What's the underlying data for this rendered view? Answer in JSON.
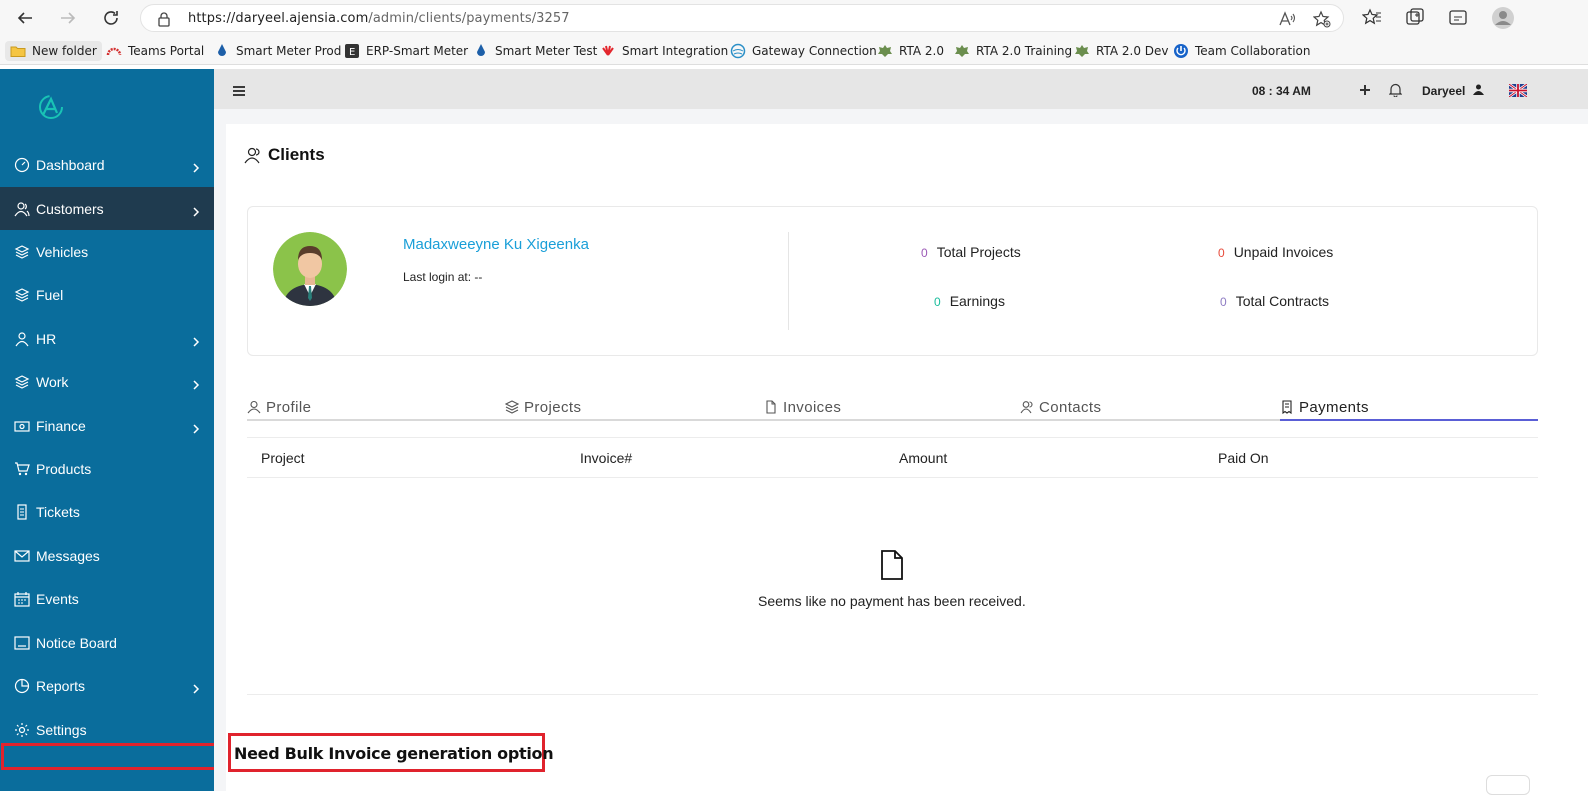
{
  "browser": {
    "url_host": "https://daryeel.ajensia.com",
    "url_path": "/admin/clients/payments/3257"
  },
  "bookmarks": [
    {
      "label": "New folder",
      "icon": "folder-icon"
    },
    {
      "label": "Teams Portal",
      "icon": "teams-portal-icon"
    },
    {
      "label": "Smart Meter Prod",
      "icon": "droplet-icon"
    },
    {
      "label": "ERP-Smart Meter",
      "icon": "e-badge-icon"
    },
    {
      "label": "Smart Meter Test",
      "icon": "droplet-icon"
    },
    {
      "label": "Smart Integration",
      "icon": "huawei-icon"
    },
    {
      "label": "Gateway Connection",
      "icon": "globe-icon"
    },
    {
      "label": "RTA 2.0",
      "icon": "emblem-icon"
    },
    {
      "label": "RTA 2.0 Training",
      "icon": "emblem-icon"
    },
    {
      "label": "RTA 2.0 Dev",
      "icon": "emblem-icon"
    },
    {
      "label": "Team Collaboration",
      "icon": "power-icon"
    }
  ],
  "sidebar": {
    "items": [
      {
        "label": "Dashboard",
        "icon": "dashboard-icon",
        "chevron": true
      },
      {
        "label": "Customers",
        "icon": "users-icon",
        "chevron": true,
        "active": true
      },
      {
        "label": "Vehicles",
        "icon": "layers-icon"
      },
      {
        "label": "Fuel",
        "icon": "layers-icon"
      },
      {
        "label": "HR",
        "icon": "user-icon",
        "chevron": true
      },
      {
        "label": "Work",
        "icon": "layers-icon",
        "chevron": true
      },
      {
        "label": "Finance",
        "icon": "money-icon",
        "chevron": true
      },
      {
        "label": "Products",
        "icon": "cart-icon"
      },
      {
        "label": "Tickets",
        "icon": "ticket-icon"
      },
      {
        "label": "Messages",
        "icon": "mail-icon"
      },
      {
        "label": "Events",
        "icon": "calendar-icon"
      },
      {
        "label": "Notice Board",
        "icon": "board-icon"
      },
      {
        "label": "Reports",
        "icon": "pie-icon",
        "chevron": true
      },
      {
        "label": "Settings",
        "icon": "gear-icon"
      }
    ]
  },
  "topbar": {
    "time": "08 : 34 AM",
    "user": "Daryeel"
  },
  "page": {
    "title": "Clients"
  },
  "client": {
    "name": "Madaxweeyne Ku Xigeenka",
    "last_login": "Last login at: --",
    "stats": [
      {
        "value": "0",
        "label": "Total Projects",
        "color": "#9b59b6"
      },
      {
        "value": "0",
        "label": "Unpaid Invoices",
        "color": "#e74c3c"
      },
      {
        "value": "0",
        "label": "Earnings",
        "color": "#1abc9c"
      },
      {
        "value": "0",
        "label": "Total Contracts",
        "color": "#8e7cc3"
      }
    ]
  },
  "tabs": [
    {
      "label": "Profile",
      "icon": "user-icon"
    },
    {
      "label": "Projects",
      "icon": "layers-icon"
    },
    {
      "label": "Invoices",
      "icon": "file-icon"
    },
    {
      "label": "Contacts",
      "icon": "users-icon"
    },
    {
      "label": "Payments",
      "icon": "receipt-icon",
      "active": true
    }
  ],
  "table": {
    "columns": [
      "Project",
      "Invoice#",
      "Amount",
      "Paid On"
    ],
    "empty_text": "Seems like no payment has been received."
  },
  "annotation": {
    "text": "Need Bulk Invoice generation option"
  }
}
